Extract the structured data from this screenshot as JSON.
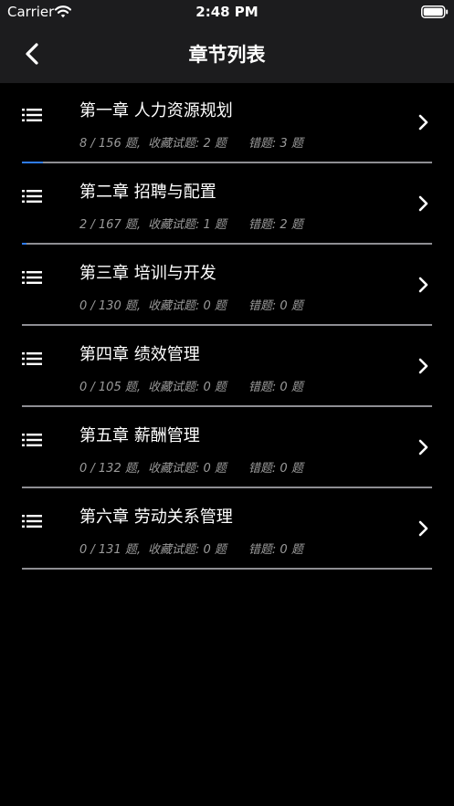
{
  "status": {
    "carrier": "Carrier",
    "time": "2:48 PM"
  },
  "nav": {
    "title": "章节列表",
    "back_icon": "chevron-left-icon"
  },
  "colors": {
    "background": "#000000",
    "bar": "#1c1c1e",
    "accent": "#2f7cf6",
    "track": "#8e8e93",
    "secondary_text": "#9a9a9a"
  },
  "chapters": [
    {
      "title": "第一章 人力资源规划",
      "count": "8 / 156 题,",
      "fav": "收藏试题: 2 题",
      "wrong": "错题: 3 题",
      "progress": 0.051
    },
    {
      "title": "第二章 招聘与配置",
      "count": "2 / 167 题,",
      "fav": "收藏试题: 1 题",
      "wrong": "错题: 2 题",
      "progress": 0.012
    },
    {
      "title": "第三章 培训与开发",
      "count": "0 / 130 题,",
      "fav": "收藏试题: 0 题",
      "wrong": "错题: 0 题",
      "progress": 0
    },
    {
      "title": "第四章 绩效管理",
      "count": "0 / 105 题,",
      "fav": "收藏试题: 0 题",
      "wrong": "错题: 0 题",
      "progress": 0
    },
    {
      "title": "第五章 薪酬管理",
      "count": "0 / 132 题,",
      "fav": "收藏试题: 0 题",
      "wrong": "错题: 0 题",
      "progress": 0
    },
    {
      "title": "第六章 劳动关系管理",
      "count": "0 / 131 题,",
      "fav": "收藏试题: 0 题",
      "wrong": "错题: 0 题",
      "progress": 0
    }
  ]
}
